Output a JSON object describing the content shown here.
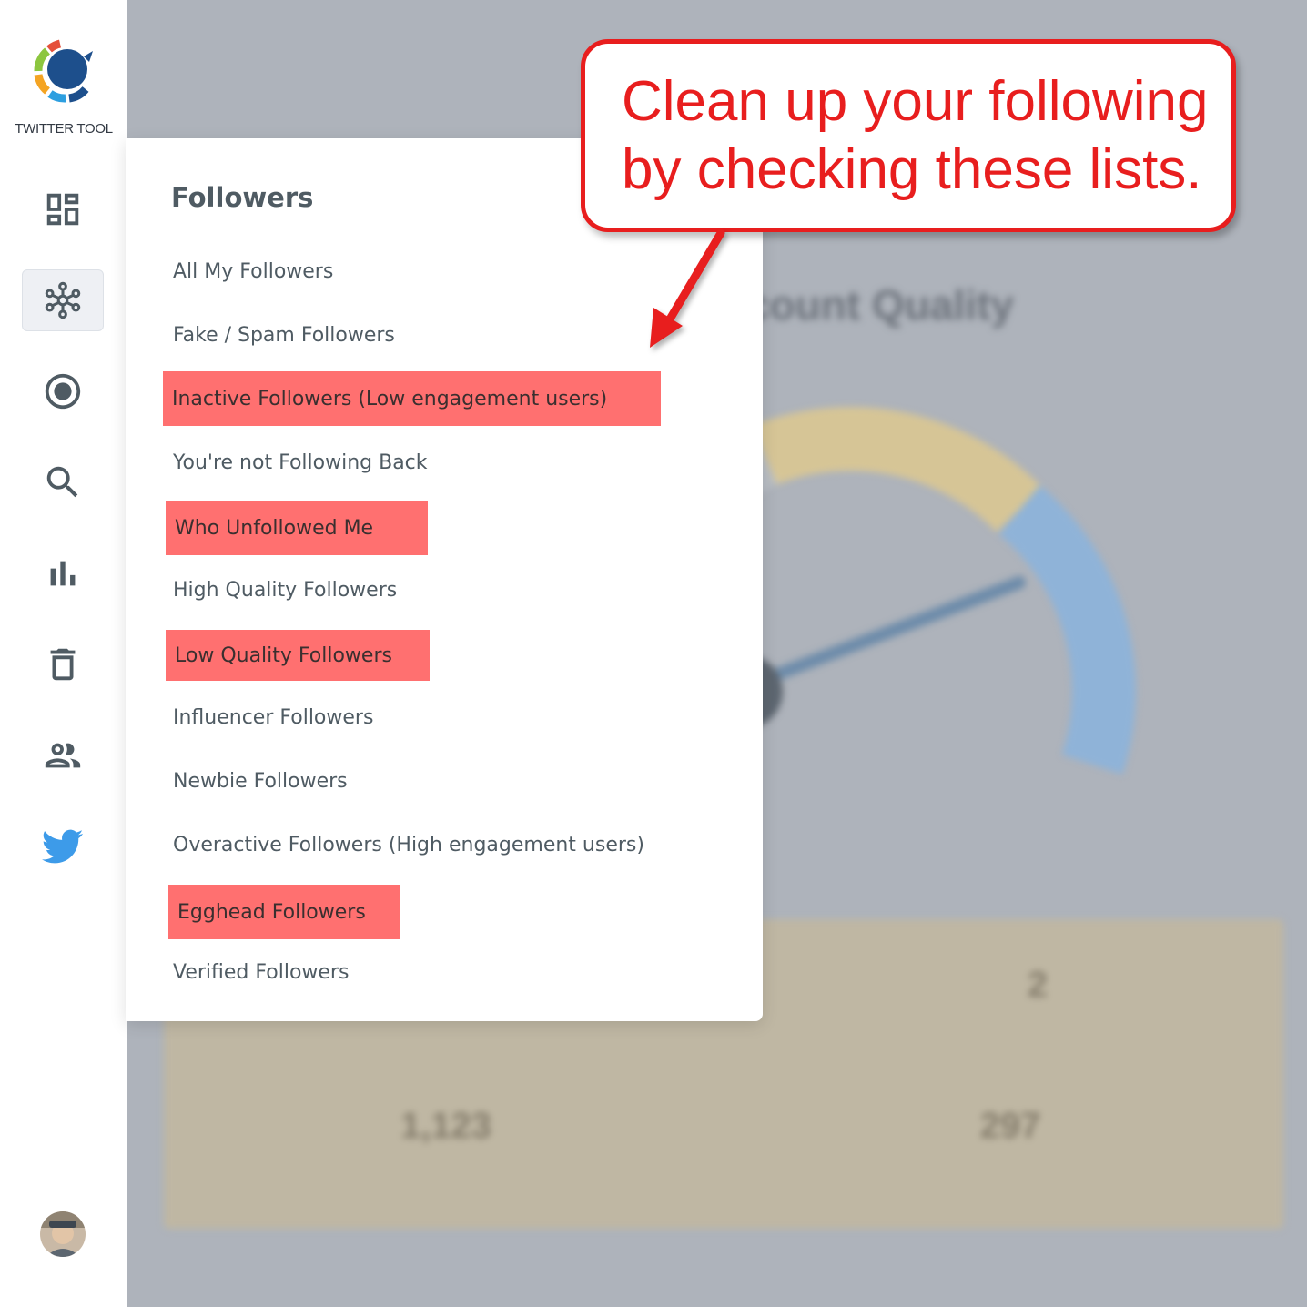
{
  "app": {
    "brand": "TWITTER TOOL"
  },
  "sidebar": {
    "nav": [
      {
        "icon": "dashboard-icon",
        "active": false
      },
      {
        "icon": "network-hub-icon",
        "active": true
      },
      {
        "icon": "radio-target-icon",
        "active": false
      },
      {
        "icon": "search-icon",
        "active": false
      },
      {
        "icon": "bar-chart-icon",
        "active": false
      },
      {
        "icon": "trash-icon",
        "active": false
      },
      {
        "icon": "people-icon",
        "active": false
      },
      {
        "icon": "twitter-bird-icon",
        "active": false
      }
    ],
    "avatar_icon": "user-avatar"
  },
  "followers_menu": {
    "title": "Followers",
    "items": [
      {
        "label": "All My Followers",
        "highlighted": false
      },
      {
        "label": "Fake / Spam Followers",
        "highlighted": false
      },
      {
        "label": "Inactive Followers (Low engagement users)",
        "highlighted": true
      },
      {
        "label": "You're not Following Back",
        "highlighted": false
      },
      {
        "label": "Who Unfollowed Me",
        "highlighted": true
      },
      {
        "label": "High Quality Followers",
        "highlighted": false
      },
      {
        "label": "Low Quality Followers",
        "highlighted": true
      },
      {
        "label": "Influencer Followers",
        "highlighted": false
      },
      {
        "label": "Newbie Followers",
        "highlighted": false
      },
      {
        "label": "Overactive Followers (High engagement users)",
        "highlighted": false
      },
      {
        "label": "Egghead Followers",
        "highlighted": true
      },
      {
        "label": "Verified Followers",
        "highlighted": false
      }
    ]
  },
  "callout": {
    "line1": "Clean up your following",
    "line2": "by checking these lists."
  },
  "background_dashboard": {
    "heading": "count Quality",
    "stats": [
      {
        "value": "2"
      },
      {
        "value": "1,123"
      },
      {
        "value": "297"
      }
    ]
  },
  "colors": {
    "highlight": "#ff7070",
    "callout_red": "#e81e1e",
    "text": "#4f5b63",
    "twitter_blue": "#3d9be9"
  }
}
